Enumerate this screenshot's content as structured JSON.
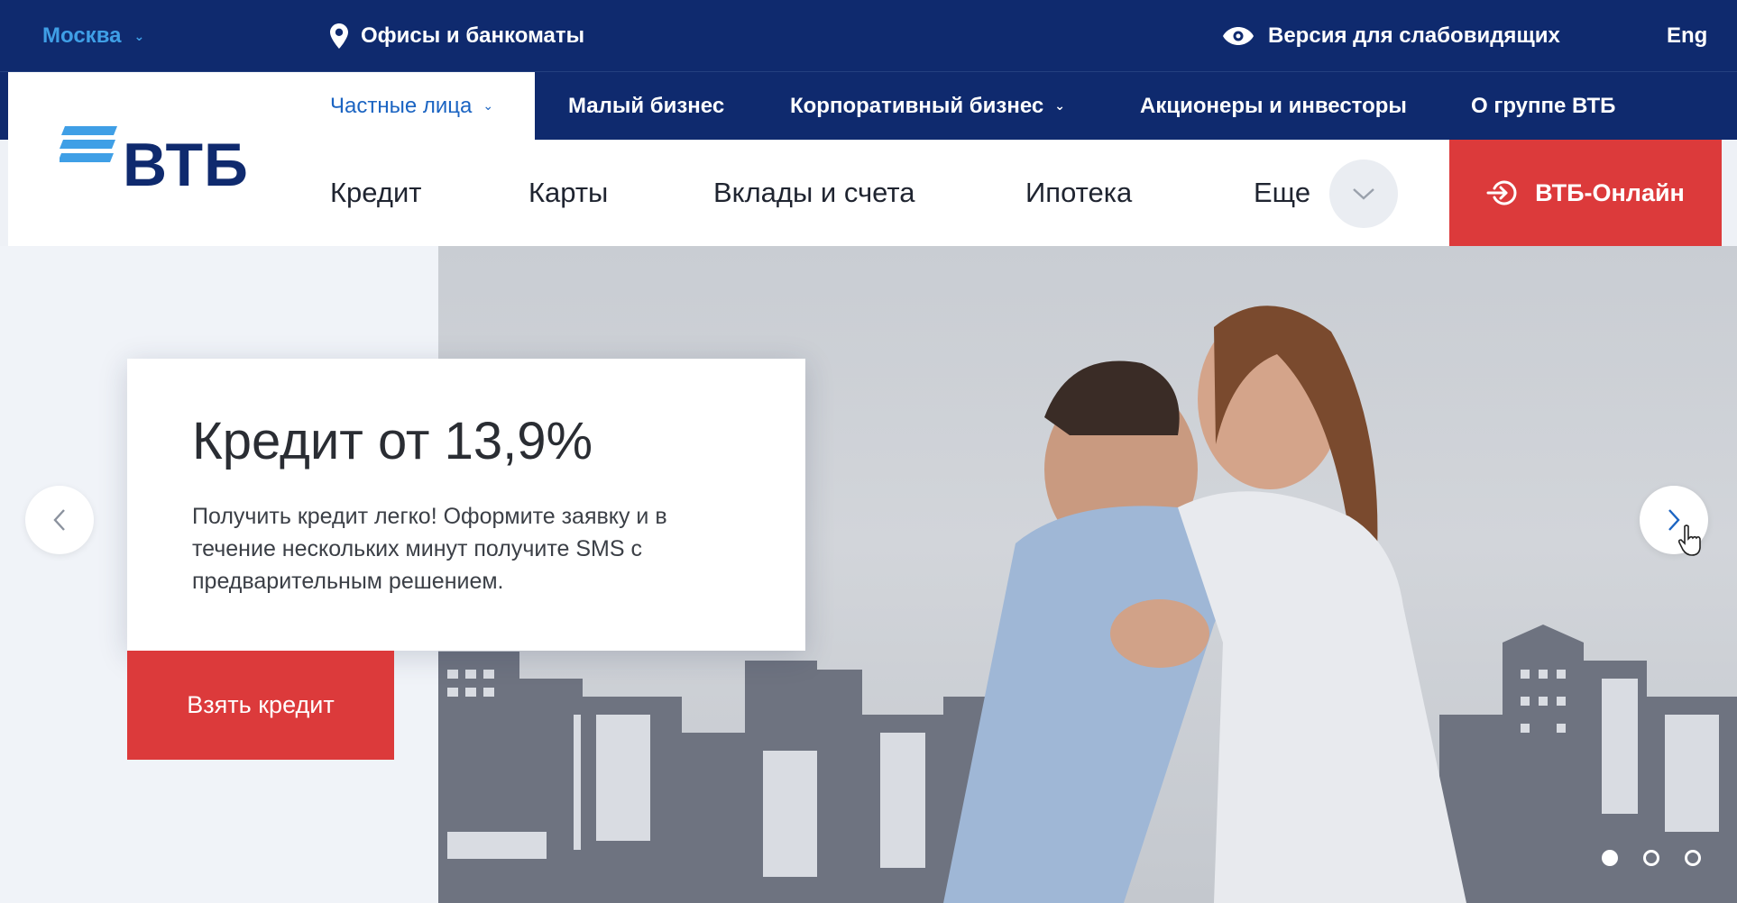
{
  "topbar": {
    "city": "Москва",
    "offices": "Офисы и банкоматы",
    "accessibility": "Версия для слабовидящих",
    "language": "Eng"
  },
  "main_nav": {
    "tabs": [
      {
        "label": "Частные лица",
        "active": true,
        "dropdown": true
      },
      {
        "label": "Малый бизнес",
        "active": false,
        "dropdown": false
      },
      {
        "label": "Корпоративный бизнес",
        "active": false,
        "dropdown": true
      },
      {
        "label": "Акционеры и инвесторы",
        "active": false,
        "dropdown": false
      },
      {
        "label": "О группе ВТБ",
        "active": false,
        "dropdown": false
      }
    ]
  },
  "logo": {
    "text": "ВТБ"
  },
  "sub_nav": {
    "links": [
      "Кредит",
      "Карты",
      "Вклады и счета",
      "Ипотека",
      "Еще"
    ]
  },
  "online_button": "ВТБ-Онлайн",
  "hero": {
    "title": "Кредит от 13,9%",
    "text": "Получить кредит легко! Оформите заявку и в течение нескольких минут получите SMS с предварительным решением.",
    "cta": "Взять кредит",
    "slides": 3,
    "active_slide": 1
  },
  "colors": {
    "navy": "#0f2a6e",
    "accent_blue": "#1b64c2",
    "light_blue": "#3f9fe6",
    "red": "#dc3a3b"
  },
  "icons": {
    "city_dropdown": "chevron-down-icon",
    "offices": "map-pin-icon",
    "accessibility": "eye-icon",
    "more": "chevron-down-icon",
    "online": "login-icon",
    "prev": "chevron-left-icon",
    "next": "chevron-right-icon"
  }
}
